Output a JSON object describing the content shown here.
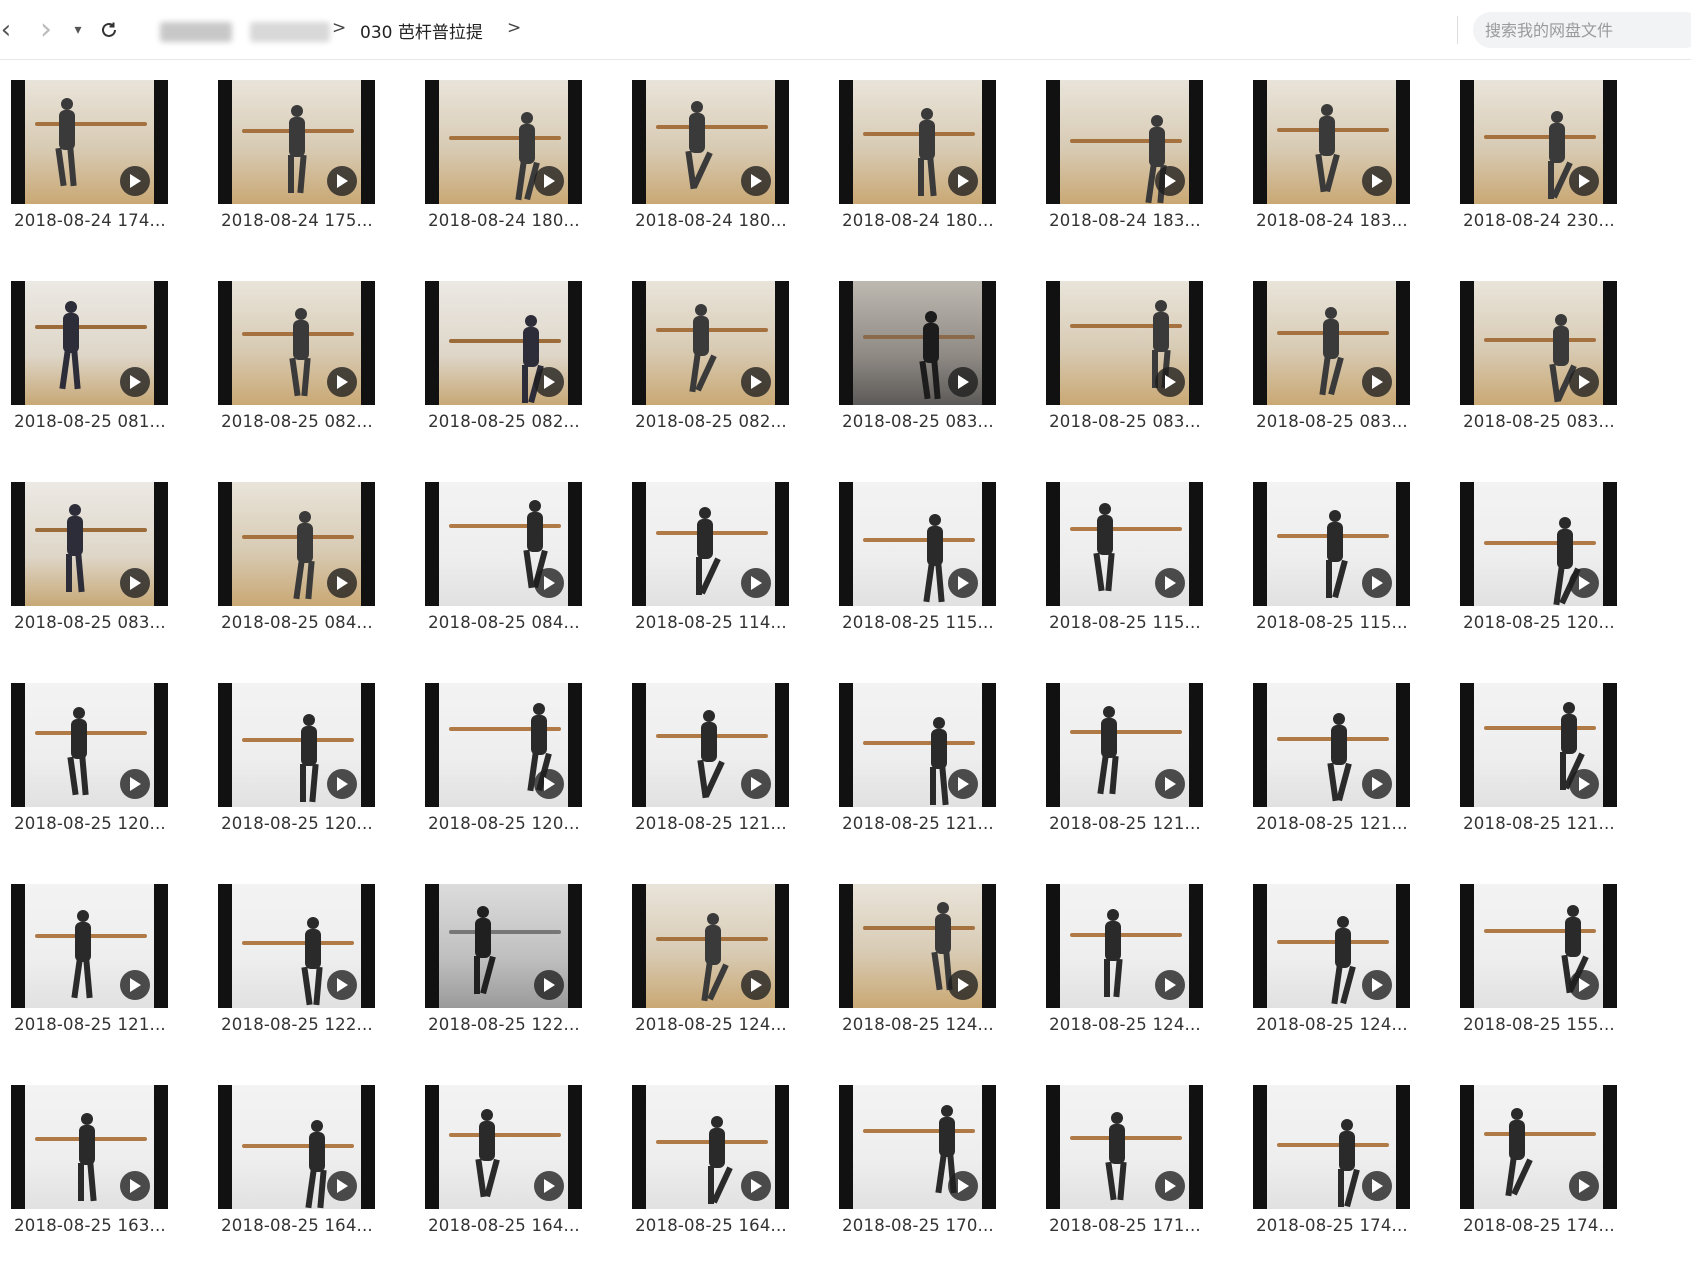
{
  "toolbar": {
    "back_icon": "‹",
    "forward_icon": "›",
    "dropdown_icon": "▾",
    "refresh_icon": "⟳",
    "crumb_separator": ">",
    "current_folder": "030 芭杆普拉提",
    "search_placeholder": "搜索我的网盘文件"
  },
  "colors": {
    "accent": "#333333"
  },
  "files": [
    {
      "name": "2018-08-24 174...",
      "scene": "warm"
    },
    {
      "name": "2018-08-24 175...",
      "scene": "warm"
    },
    {
      "name": "2018-08-24 180...",
      "scene": "warm"
    },
    {
      "name": "2018-08-24 180...",
      "scene": "warm"
    },
    {
      "name": "2018-08-24 180...",
      "scene": "warm"
    },
    {
      "name": "2018-08-24 183...",
      "scene": "warm"
    },
    {
      "name": "2018-08-24 183...",
      "scene": "warm"
    },
    {
      "name": "2018-08-24 230...",
      "scene": "warm"
    },
    {
      "name": "2018-08-25 081...",
      "scene": "studio"
    },
    {
      "name": "2018-08-25 082...",
      "scene": "warm"
    },
    {
      "name": "2018-08-25 082...",
      "scene": "studio"
    },
    {
      "name": "2018-08-25 082...",
      "scene": "warm"
    },
    {
      "name": "2018-08-25 083...",
      "scene": "dark"
    },
    {
      "name": "2018-08-25 083...",
      "scene": "warm"
    },
    {
      "name": "2018-08-25 083...",
      "scene": "warm"
    },
    {
      "name": "2018-08-25 083...",
      "scene": "warm"
    },
    {
      "name": "2018-08-25 083...",
      "scene": "studio"
    },
    {
      "name": "2018-08-25 084...",
      "scene": "warm"
    },
    {
      "name": "2018-08-25 084...",
      "scene": "white"
    },
    {
      "name": "2018-08-25 114...",
      "scene": "white"
    },
    {
      "name": "2018-08-25 115...",
      "scene": "white"
    },
    {
      "name": "2018-08-25 115...",
      "scene": "white"
    },
    {
      "name": "2018-08-25 115...",
      "scene": "white"
    },
    {
      "name": "2018-08-25 120...",
      "scene": "white"
    },
    {
      "name": "2018-08-25 120...",
      "scene": "white"
    },
    {
      "name": "2018-08-25 120...",
      "scene": "white"
    },
    {
      "name": "2018-08-25 120...",
      "scene": "white"
    },
    {
      "name": "2018-08-25 121...",
      "scene": "white"
    },
    {
      "name": "2018-08-25 121...",
      "scene": "white"
    },
    {
      "name": "2018-08-25 121...",
      "scene": "white"
    },
    {
      "name": "2018-08-25 121...",
      "scene": "white"
    },
    {
      "name": "2018-08-25 121...",
      "scene": "white"
    },
    {
      "name": "2018-08-25 121...",
      "scene": "white"
    },
    {
      "name": "2018-08-25 122...",
      "scene": "white"
    },
    {
      "name": "2018-08-25 122...",
      "scene": "grey"
    },
    {
      "name": "2018-08-25 124...",
      "scene": "warm"
    },
    {
      "name": "2018-08-25 124...",
      "scene": "warm"
    },
    {
      "name": "2018-08-25 124...",
      "scene": "white"
    },
    {
      "name": "2018-08-25 124...",
      "scene": "white"
    },
    {
      "name": "2018-08-25 155...",
      "scene": "white"
    },
    {
      "name": "2018-08-25 163...",
      "scene": "white"
    },
    {
      "name": "2018-08-25 164...",
      "scene": "white"
    },
    {
      "name": "2018-08-25 164...",
      "scene": "white"
    },
    {
      "name": "2018-08-25 164...",
      "scene": "white"
    },
    {
      "name": "2018-08-25 170...",
      "scene": "white"
    },
    {
      "name": "2018-08-25 171...",
      "scene": "white"
    },
    {
      "name": "2018-08-25 174...",
      "scene": "white"
    },
    {
      "name": "2018-08-25 174...",
      "scene": "white"
    }
  ]
}
